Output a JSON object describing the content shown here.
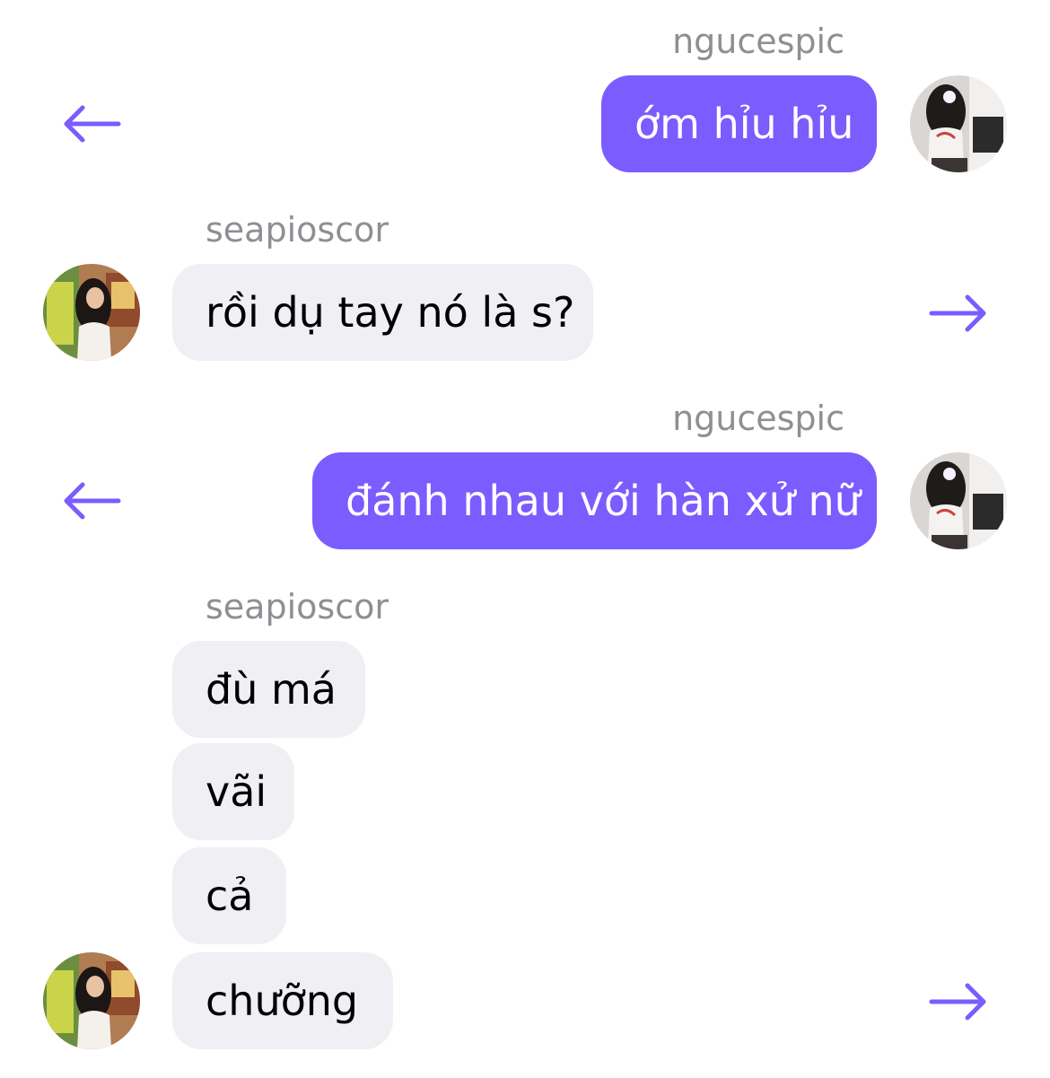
{
  "colors": {
    "accent": "#7b5cff",
    "incoming_bubble": "#efeff4",
    "username": "#8e8e93"
  },
  "messages": [
    {
      "sender": "ngucespic",
      "direction": "outgoing",
      "text": "ớm hỉu hỉu",
      "reply_icon": "arrow-left-icon",
      "avatar": "avatar-ngucespic"
    },
    {
      "sender": "seapioscor",
      "direction": "incoming",
      "text": "rồi dụ tay nó là s?",
      "forward_icon": "arrow-right-icon",
      "avatar": "avatar-seapioscor"
    },
    {
      "sender": "ngucespic",
      "direction": "outgoing",
      "text": "đánh nhau với hàn xử nữ",
      "reply_icon": "arrow-left-icon",
      "avatar": "avatar-ngucespic"
    },
    {
      "sender": "seapioscor",
      "direction": "incoming",
      "group": [
        "đù má",
        "vãi",
        "cả",
        "chưỡng"
      ],
      "forward_icon": "arrow-right-icon",
      "avatar": "avatar-seapioscor"
    }
  ]
}
